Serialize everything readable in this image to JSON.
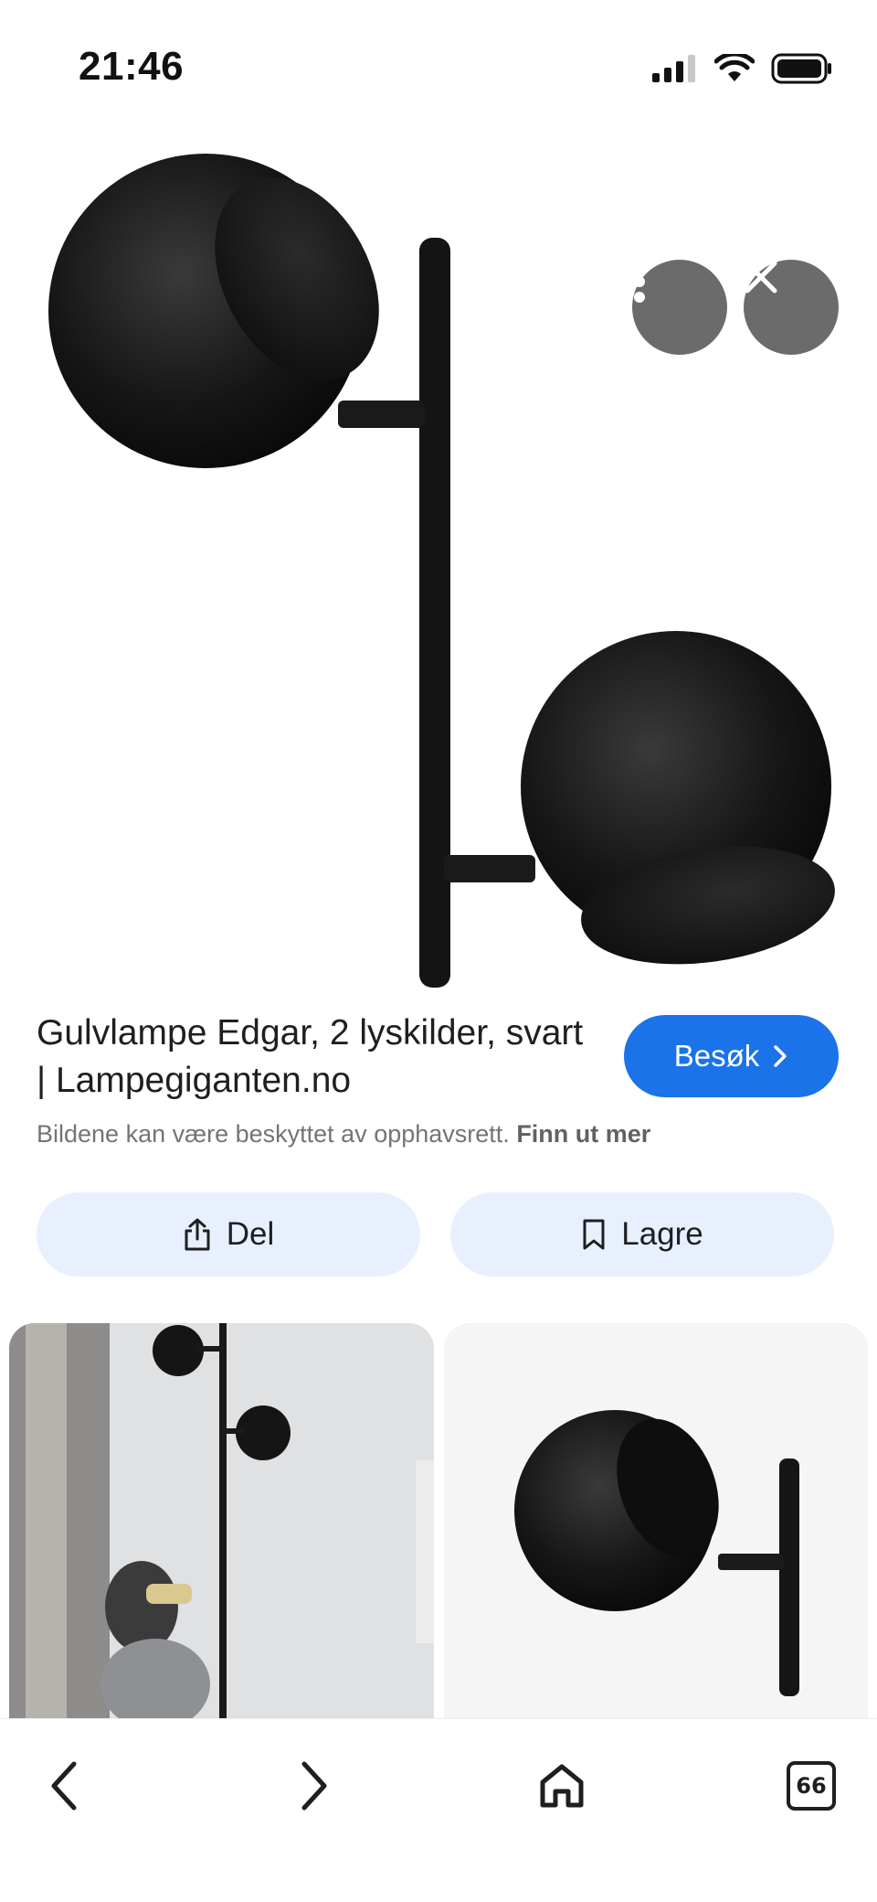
{
  "status_bar": {
    "time": "21:46",
    "icons": [
      "cellular-signal-icon",
      "wifi-icon",
      "battery-icon"
    ]
  },
  "viewer": {
    "more_icon": "more-vert-icon",
    "close_icon": "close-icon"
  },
  "result": {
    "title": "Gulvlampe Edgar, 2 lyskilder, svart | Lampegiganten.no",
    "visit_label": "Besøk",
    "copyright_text": "Bildene kan være beskyttet av opphavsrett.",
    "learn_more_label": "Finn ut mer",
    "share_label": "Del",
    "save_label": "Lagre"
  },
  "bottom_nav": {
    "back_icon": "chevron-left-icon",
    "forward_icon": "chevron-right-icon",
    "home_icon": "home-icon",
    "tabs_count": "66"
  },
  "colors": {
    "accent": "#1a73e8",
    "pill_background": "#e8f0fe",
    "overlay_button": "#6b6b6b"
  }
}
